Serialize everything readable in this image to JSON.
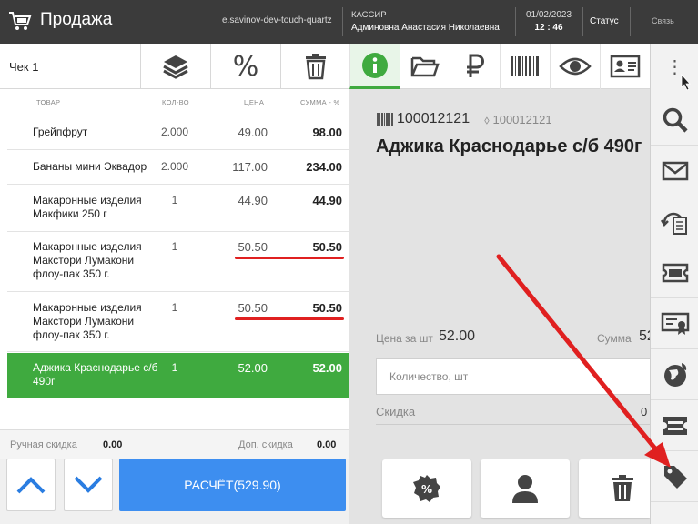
{
  "header": {
    "title": "Продажа",
    "server": "e.savinov-dev-touch-quartz",
    "cashier_role": "КАССИР",
    "cashier_name": "Админовна Анастасия Николаевна",
    "date": "01/02/2023",
    "time": "12 : 46",
    "status_label": "Статус",
    "link_label": "Связь"
  },
  "check": {
    "label": "Чек 1",
    "percent_glyph": "%"
  },
  "table": {
    "columns": [
      "ТОВАР",
      "КОЛ-ВО",
      "ЦЕНА",
      "СУММА - %"
    ],
    "rows": [
      {
        "name": "Грейпфрут",
        "qty": "2.000",
        "price": "49.00",
        "sum": "98.00"
      },
      {
        "name": "Бананы мини Эквадор",
        "qty": "2.000",
        "price": "117.00",
        "sum": "234.00"
      },
      {
        "name": "Макаронные изделия Макфики 250 г",
        "qty": "1",
        "price": "44.90",
        "sum": "44.90"
      },
      {
        "name": "Макаронные изделия Макстори Лумакони флоу-пак 350 г.",
        "qty": "1",
        "price": "50.50",
        "sum": "50.50"
      },
      {
        "name": "Макаронные изделия Макстори Лумакони флоу-пак 350 г.",
        "qty": "1",
        "price": "50.50",
        "sum": "50.50"
      },
      {
        "name": "Аджика Краснодарье с/б 490г",
        "qty": "1",
        "price": "52.00",
        "sum": "52.00"
      }
    ]
  },
  "discount_bar": {
    "manual_label": "Ручная скидка",
    "manual_value": "0.00",
    "extra_label": "Доп. скидка",
    "extra_value": "0.00"
  },
  "pay_button": "РАСЧЁТ(529.90)",
  "product": {
    "barcode": "100012121",
    "code": "100012121",
    "name": "Аджика Краснодарье с/б 490г",
    "price_label": "Цена за шт",
    "price_value": "52.00",
    "sum_label": "Сумма",
    "sum_value": "52",
    "qty_placeholder": "Количество, шт",
    "discount_label": "Скидка",
    "discount_value": "0"
  },
  "icons": {
    "cart": "cart-icon",
    "layers": "layers-icon",
    "trash": "trash-icon",
    "info": "info-icon",
    "folder": "folder-icon",
    "ruble": "ruble-icon",
    "barcode": "barcode-icon",
    "eye": "eye-icon",
    "id_card": "id-card-icon",
    "search": "search-icon",
    "mail": "mail-icon",
    "tag": "tag-icon"
  },
  "colors": {
    "accent_green": "#3faa3f",
    "accent_blue": "#3d8ef0",
    "annotation_red": "#e02020",
    "topbar": "#3b3b3b"
  }
}
